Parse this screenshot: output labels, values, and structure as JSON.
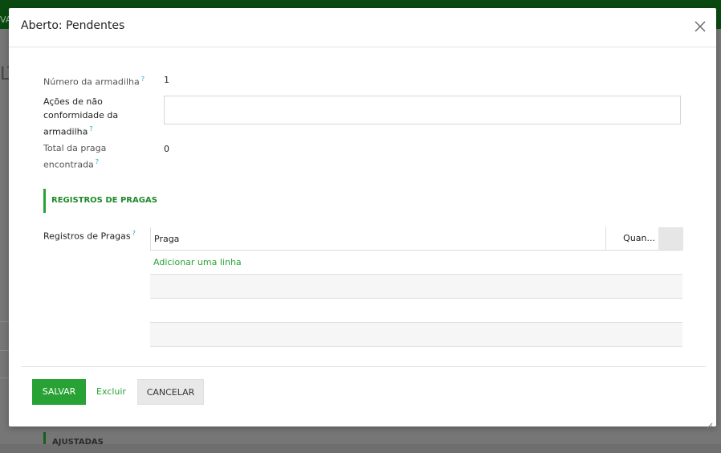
{
  "background": {
    "topbar_text": "VA",
    "left_text": "LT",
    "bottom_section_label": "AJUSTADAS"
  },
  "modal": {
    "title": "Aberto: Pendentes",
    "close_icon": "close-icon",
    "fields": {
      "trap_number": {
        "label": "Número da armadilha",
        "help": "?",
        "value": "1"
      },
      "nonconformity_actions": {
        "label_line1": "Ações de não",
        "label_line2": "conformidade da",
        "label_line3": "armadilha",
        "help": "?",
        "value": ""
      },
      "total_pests": {
        "label_line1": "Total da praga",
        "label_line2": "encontrada",
        "help": "?",
        "value": "0"
      }
    },
    "section": {
      "title": "REGISTROS DE PRAGAS"
    },
    "pest_records": {
      "label": "Registros de Pragas",
      "help": "?",
      "columns": [
        "Praga",
        "Quan..."
      ],
      "add_line": "Adicionar uma linha"
    },
    "footer": {
      "save_label": "SALVAR",
      "delete_label": "Excluir",
      "cancel_label": "CANCELAR"
    }
  },
  "colors": {
    "accent": "#28a234",
    "help": "#27a4c8",
    "topbar": "#0a4a10"
  }
}
